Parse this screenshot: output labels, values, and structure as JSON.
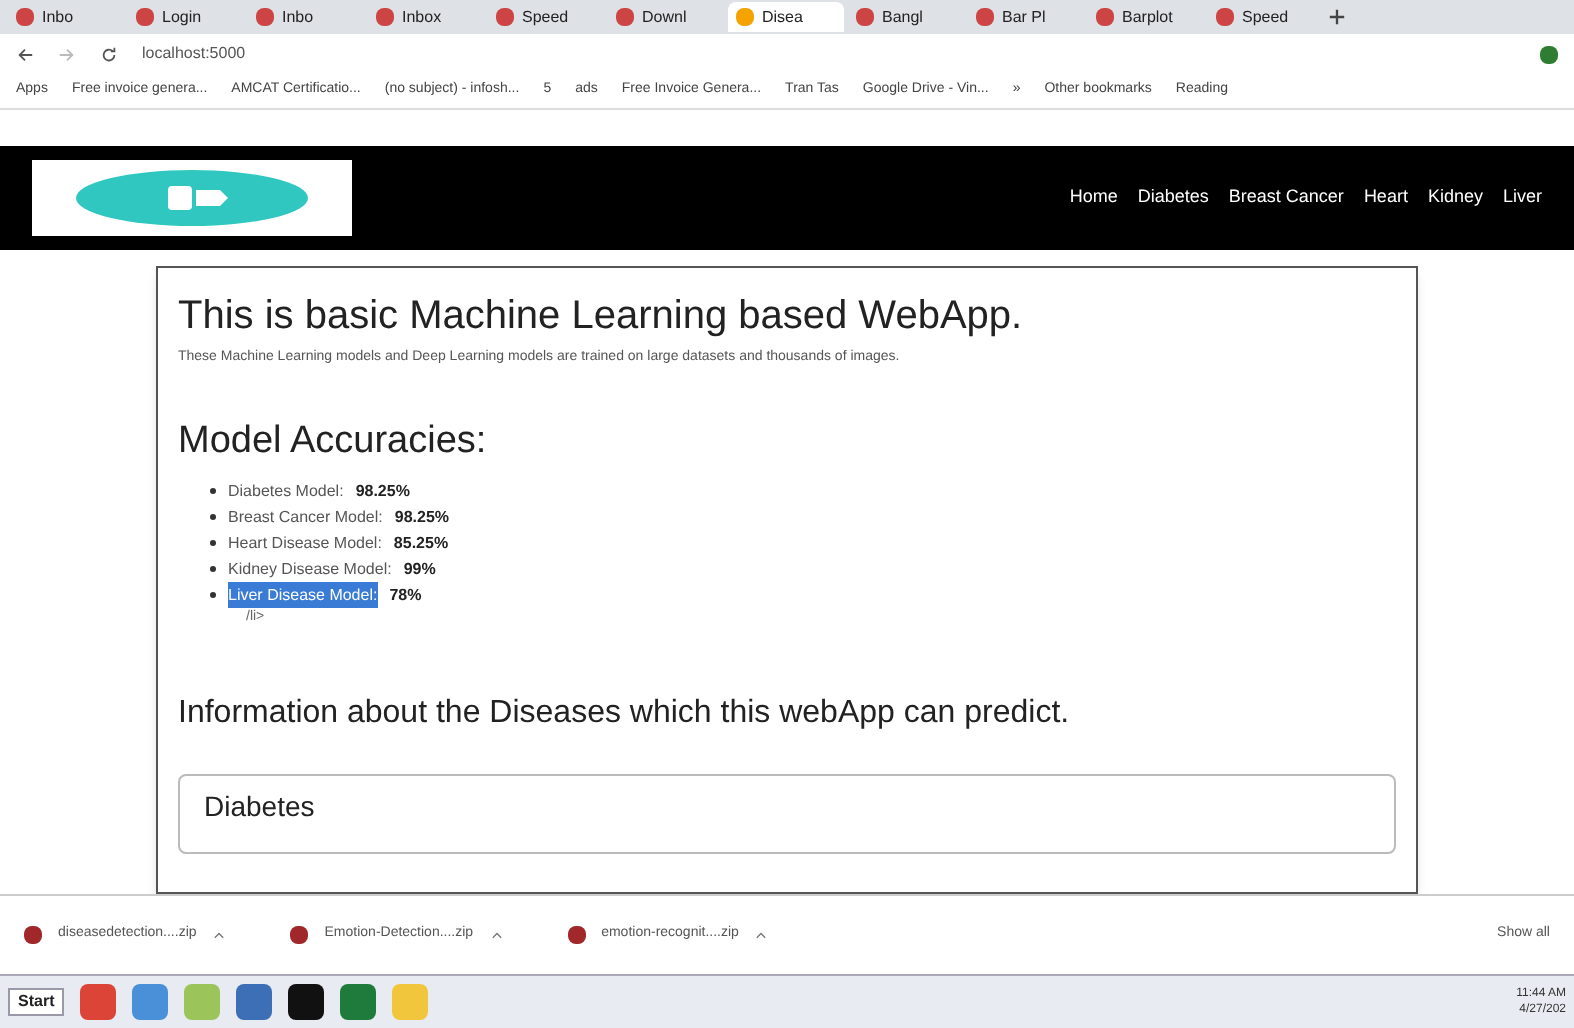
{
  "browser": {
    "tabs": [
      {
        "title": "Inbo",
        "selected": false
      },
      {
        "title": "Login",
        "selected": false
      },
      {
        "title": "Inbo",
        "selected": false
      },
      {
        "title": "Inbox",
        "selected": false
      },
      {
        "title": "Speed",
        "selected": false
      },
      {
        "title": "Downl",
        "selected": false
      },
      {
        "title": "Disea",
        "selected": true
      },
      {
        "title": "Bangl",
        "selected": false
      },
      {
        "title": "Bar Pl",
        "selected": false
      },
      {
        "title": "Barplot",
        "selected": false
      },
      {
        "title": "Speed",
        "selected": false
      }
    ],
    "address": "localhost:5000",
    "bookmarks": [
      "Apps",
      "Free invoice genera...",
      "AMCAT Certificatio...",
      "(no subject) - infosh...",
      "5",
      "ads",
      "Free Invoice Genera...",
      "Tran Tas",
      "Google Drive - Vin...",
      "»",
      "Other bookmarks",
      "Reading"
    ]
  },
  "navbar": {
    "links": [
      "Home",
      "Diabetes",
      "Breast Cancer",
      "Heart",
      "Kidney",
      "Liver"
    ]
  },
  "content": {
    "title": "This is basic Machine Learning based WebApp.",
    "subtitle": "These Machine Learning models and Deep Learning models are trained on large datasets and thousands of images.",
    "accuracies_heading": "Model Accuracies:",
    "accuracies": [
      {
        "label": "Diabetes Model:",
        "value": "98.25%",
        "selected": false
      },
      {
        "label": "Breast Cancer Model:",
        "value": "98.25%",
        "selected": false
      },
      {
        "label": "Heart Disease Model:",
        "value": "85.25%",
        "selected": false
      },
      {
        "label": "Kidney Disease Model:",
        "value": "99%",
        "selected": false
      },
      {
        "label": "Liver Disease Model:",
        "value": "78%",
        "selected": true
      }
    ],
    "stray_text": "/li>",
    "info_heading": "Information about the Diseases which this webApp can predict.",
    "card_heading": "Diabetes"
  },
  "downloads": {
    "files": [
      "diseasedetection....zip",
      "Emotion-Detection....zip",
      "emotion-recognit....zip"
    ],
    "show_all": "Show all"
  },
  "taskbar": {
    "start": "Start",
    "time": "11:44 AM",
    "date": "4/27/202"
  }
}
